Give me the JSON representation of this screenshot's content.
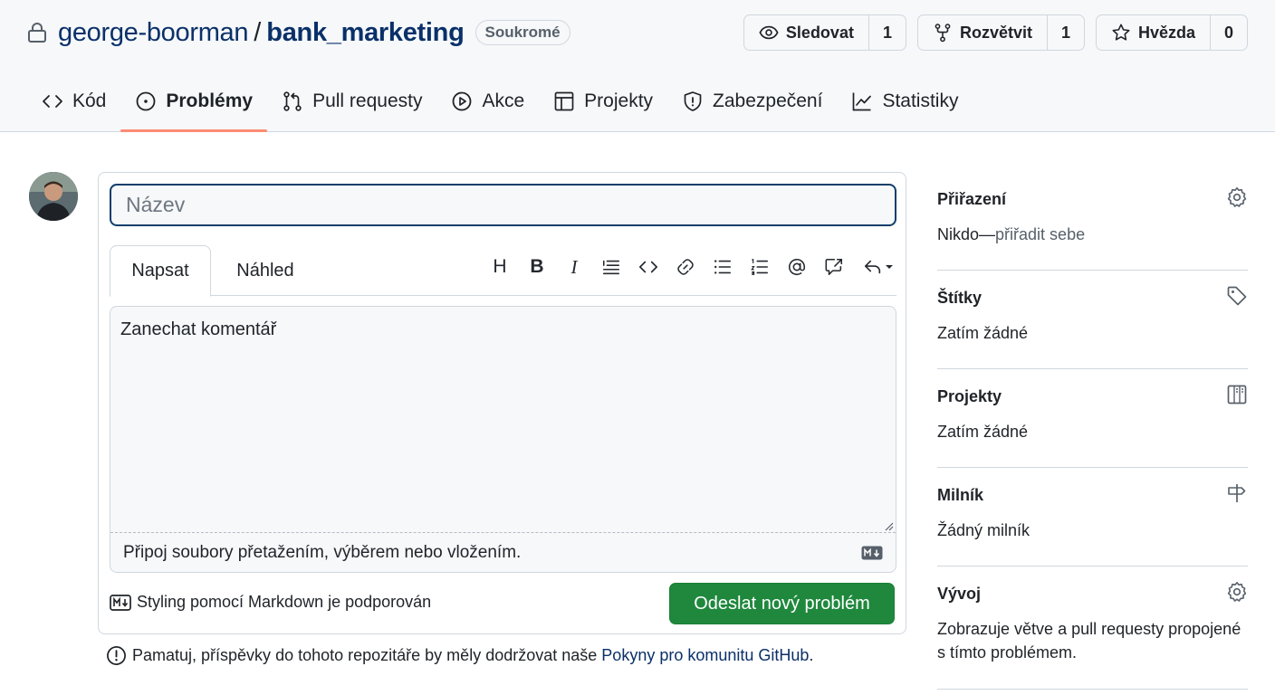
{
  "repo": {
    "owner": "george-boorman",
    "separator": "/",
    "name": "bank_marketing",
    "visibility": "Soukromé"
  },
  "actions": {
    "watch": {
      "label": "Sledovat",
      "count": "1"
    },
    "fork": {
      "label": "Rozvětvit",
      "count": "1"
    },
    "star": {
      "label": "Hvězda",
      "count": "0"
    }
  },
  "nav": {
    "items": [
      {
        "label": "Kód",
        "icon": "code-icon"
      },
      {
        "label": "Problémy",
        "icon": "issue-icon",
        "active": true
      },
      {
        "label": "Pull requesty",
        "icon": "pull-request-icon"
      },
      {
        "label": "Akce",
        "icon": "play-icon"
      },
      {
        "label": "Projekty",
        "icon": "table-icon"
      },
      {
        "label": "Zabezpečení",
        "icon": "shield-icon"
      },
      {
        "label": "Statistiky",
        "icon": "graph-icon"
      }
    ]
  },
  "form": {
    "title_placeholder": "Název",
    "tabs": {
      "write": "Napsat",
      "preview": "Náhled"
    },
    "toolbar": {
      "heading": "H",
      "bold": "B",
      "italic": "I"
    },
    "comment_placeholder": "Zanechat komentář",
    "attach_hint": "Připoj soubory přetažením, výběrem nebo vložením.",
    "markdown_note": "Styling pomocí Markdown je podporován",
    "submit_label": "Odeslat nový problém"
  },
  "notice": {
    "text": "Pamatuj, příspěvky do tohoto repozitáře by měly dodržovat naše",
    "link": "Pokyny pro komunitu GitHub",
    "end": "."
  },
  "sidebar": {
    "assignees": {
      "title": "Přiřazení",
      "value": "Nikdo—",
      "link": "přiřadit sebe"
    },
    "labels": {
      "title": "Štítky",
      "value": "Zatím žádné"
    },
    "projects": {
      "title": "Projekty",
      "value": "Zatím žádné"
    },
    "milestone": {
      "title": "Milník",
      "value": "Žádný milník"
    },
    "development": {
      "title": "Vývoj",
      "value": "Zobrazuje větve a pull requesty propojené s tímto problémem."
    }
  },
  "colors": {
    "accent_blue": "#0a3069",
    "submit_green": "#1f883d",
    "active_tab_underline": "#fd8c73"
  }
}
